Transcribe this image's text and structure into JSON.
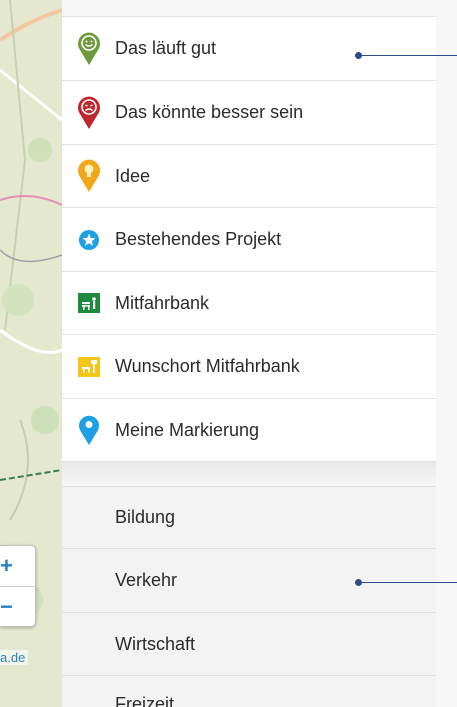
{
  "map": {
    "zoom_in": "+",
    "zoom_out": "−",
    "attribution": "a.de"
  },
  "markers": [
    {
      "label": "Das läuft gut",
      "icon": "happy-pin-icon",
      "color": "#6e9a3c"
    },
    {
      "label": "Das könnte besser sein",
      "icon": "unhappy-pin-icon",
      "color": "#c0272d"
    },
    {
      "label": "Idee",
      "icon": "lightbulb-pin-icon",
      "color": "#f2a71b"
    },
    {
      "label": "Bestehendes Projekt",
      "icon": "star-circle-icon",
      "color": "#1ea0e6"
    },
    {
      "label": "Mitfahrbank",
      "icon": "bench-icon",
      "color": "#1d8a3d"
    },
    {
      "label": "Wunschort Mitfahrbank",
      "icon": "wish-bench-icon",
      "color": "#f5c518"
    },
    {
      "label": "Meine Markierung",
      "icon": "location-pin-icon",
      "color": "#1ea0e6"
    }
  ],
  "categories": [
    {
      "label": "Bildung"
    },
    {
      "label": "Verkehr"
    },
    {
      "label": "Wirtschaft"
    },
    {
      "label": "Freizeit"
    }
  ]
}
